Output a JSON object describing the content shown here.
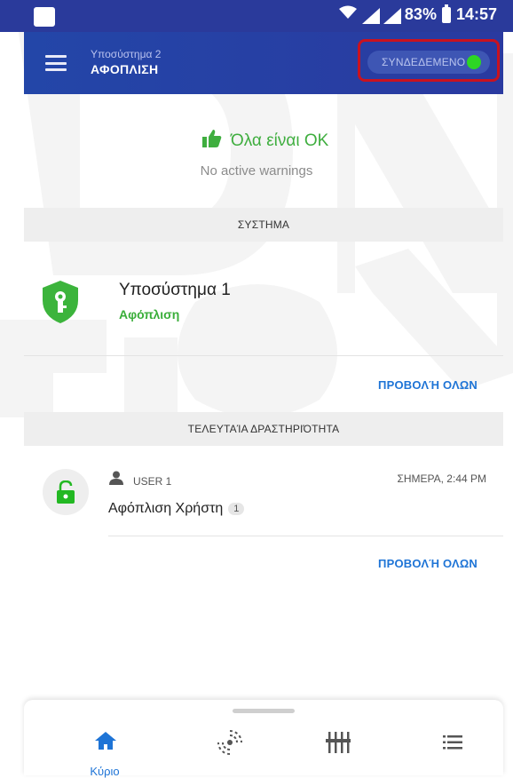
{
  "status_bar": {
    "battery": "83%",
    "time": "14:57"
  },
  "app_bar": {
    "subtitle": "Υποσύστημα 2",
    "title": "ΑΦΟΠΛΙΣΗ",
    "connection_status": "ΣΥΝΔΕΔΕΜΕΝΟ",
    "connection_color": "#2dd624"
  },
  "status": {
    "ok_text": "Όλα είναι OK",
    "warnings": "No active warnings"
  },
  "system_section": {
    "header": "ΣΥΣΤΗΜΑ",
    "subsystem_name": "Υποσύστημα 1",
    "subsystem_state": "Αφόπλιση",
    "view_all": "ΠΡΟΒΟΛΉ ΟΛΩΝ"
  },
  "activity_section": {
    "header": "ΤΕΛΕΥΤΑΊΑ ΔΡΑΣΤΗΡΙΌΤΗΤΑ",
    "user": "USER 1",
    "time": "ΣΗΜΕΡΑ, 2:44 PM",
    "description": "Αφόπλιση Χρήστη",
    "badge": "1",
    "view_all": "ΠΡΟΒΟΛΉ ΟΛΩΝ"
  },
  "bottom_nav": {
    "items": [
      {
        "icon": "home-icon",
        "label": "Κύριο"
      },
      {
        "icon": "sensors-icon",
        "label": ""
      },
      {
        "icon": "controls-icon",
        "label": ""
      },
      {
        "icon": "list-icon",
        "label": ""
      }
    ]
  },
  "colors": {
    "primary": "#2a3a9b",
    "accent": "#1e74d6",
    "success": "#3aae3a",
    "highlight": "#c9121f"
  }
}
